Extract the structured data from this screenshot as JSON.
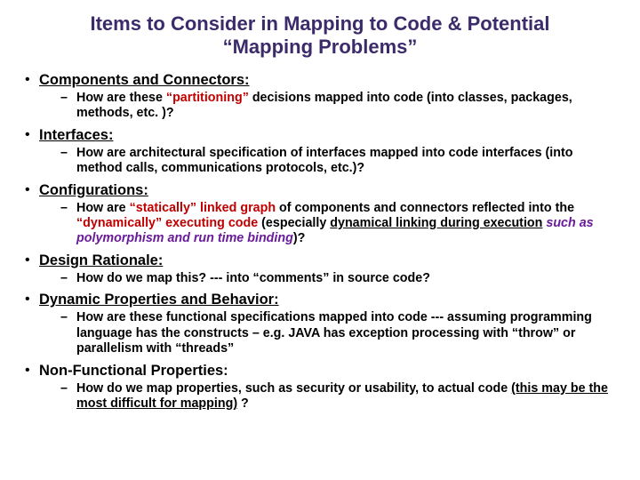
{
  "title": "Items to Consider in Mapping to Code & Potential “Mapping Problems”",
  "b1": {
    "heading": "Components and Connectors:",
    "sub_pre": "How are these ",
    "sub_red": "“partitioning”",
    "sub_post": " decisions mapped into code (into classes, packages, methods, etc. )?"
  },
  "b2": {
    "heading": "Interfaces:",
    "sub": "How are architectural specification of interfaces mapped into code interfaces (into method calls, communications protocols, etc.)?"
  },
  "b3": {
    "heading": "Configurations:",
    "p1": "How are ",
    "r1": "“statically” linked graph",
    "p2": " of components and connectors reflected into the ",
    "r2": "“dynamically” executing code",
    "p3": " (especially ",
    "u1": "dynamical linking during execution",
    "purp": " such as polymorphism and run time binding",
    "p4": ")?"
  },
  "b4": {
    "heading": "Design Rationale:",
    "sub": "How do we map this? ---  into “comments” in source code?"
  },
  "b5": {
    "heading": "Dynamic Properties and Behavior:",
    "sub": "How are these functional specifications mapped into code --- assuming programming language has the constructs – e.g. JAVA has exception processing with “throw” or parallelism with “threads”"
  },
  "b6": {
    "heading": "Non-Functional Properties:",
    "p1": "How do we map properties, such as security or usability, to actual code ",
    "u1": "(this may be the most difficult for mapping)",
    "p2": " ?"
  }
}
